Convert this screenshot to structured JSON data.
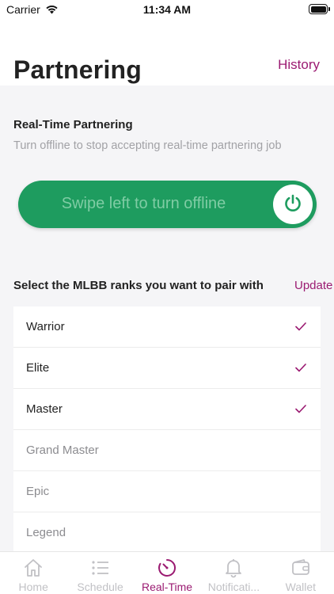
{
  "status_bar": {
    "carrier": "Carrier",
    "time": "11:34 AM"
  },
  "header": {
    "title": "Partnering",
    "history_label": "History"
  },
  "realtime": {
    "title": "Real-Time Partnering",
    "subtitle": "Turn offline to stop accepting real-time partnering job",
    "swipe_label": "Swipe left to turn offline",
    "is_online": true
  },
  "ranks": {
    "title": "Select the MLBB ranks you want to pair with",
    "update_label": "Update",
    "items": [
      {
        "label": "Warrior",
        "selected": true
      },
      {
        "label": "Elite",
        "selected": true
      },
      {
        "label": "Master",
        "selected": true
      },
      {
        "label": "Grand Master",
        "selected": false
      },
      {
        "label": "Epic",
        "selected": false
      },
      {
        "label": "Legend",
        "selected": false
      }
    ]
  },
  "tabs": [
    {
      "label": "Home",
      "icon": "home-icon",
      "active": false
    },
    {
      "label": "Schedule",
      "icon": "list-icon",
      "active": false
    },
    {
      "label": "Real-Time",
      "icon": "timer-icon",
      "active": true
    },
    {
      "label": "Notificati...",
      "icon": "bell-icon",
      "active": false
    },
    {
      "label": "Wallet",
      "icon": "wallet-icon",
      "active": false
    }
  ],
  "colors": {
    "accent": "#9b1b72",
    "toggle_green": "#1e9c5f",
    "muted": "#c1c1c5"
  }
}
